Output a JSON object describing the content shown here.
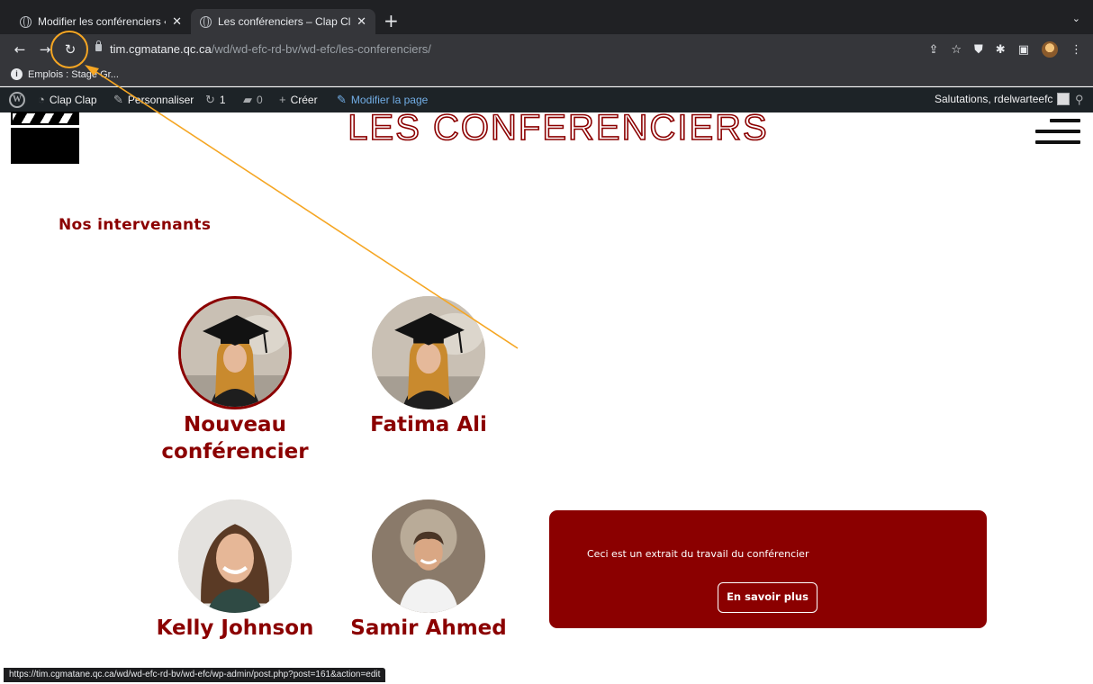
{
  "browser": {
    "tabs": [
      {
        "title": "Modifier les conférenciers « N",
        "active": false
      },
      {
        "title": "Les conférenciers – Clap Clap",
        "active": true
      }
    ],
    "new_tab_label": "+",
    "tab_close_label": "✕",
    "url_host": "tim.cgmatane.qc.ca",
    "url_path": "/wd/wd-efc-rd-bv/wd-efc/les-conferenciers/",
    "bookmarks": [
      {
        "label": "Emplois : Stage Gr..."
      }
    ],
    "status_url": "https://tim.cgmatane.qc.ca/wd/wd-efc-rd-bv/wd-efc/wp-admin/post.php?post=161&action=edit"
  },
  "wp_admin_bar": {
    "site_name": "Clap Clap",
    "customize": "Personnaliser",
    "updates_count": "1",
    "comments_count": "0",
    "new_label": "Créer",
    "edit_page": "Modifier la page",
    "greeting": "Salutations, rdelwarteefc"
  },
  "page": {
    "title": "LES CONFERENCIERS",
    "section_heading": "Nos intervenants",
    "speakers": [
      {
        "name": "Nouveau conférencier",
        "photo": "graduate-woman",
        "highlighted": true
      },
      {
        "name": "Fatima Ali",
        "photo": "graduate-woman",
        "highlighted": false
      },
      {
        "name": "Kelly Johnson",
        "photo": "smiling-woman",
        "highlighted": false
      },
      {
        "name": "Samir Ahmed",
        "photo": "smiling-man",
        "highlighted": false
      }
    ],
    "cta": {
      "excerpt": "Ceci est un extrait du travail du conférencier",
      "button": "En savoir plus"
    }
  },
  "colors": {
    "brand": "#8b0000",
    "annotation": "#f5a623",
    "browser_dark": "#202124",
    "wp_bar": "#1d2327"
  }
}
